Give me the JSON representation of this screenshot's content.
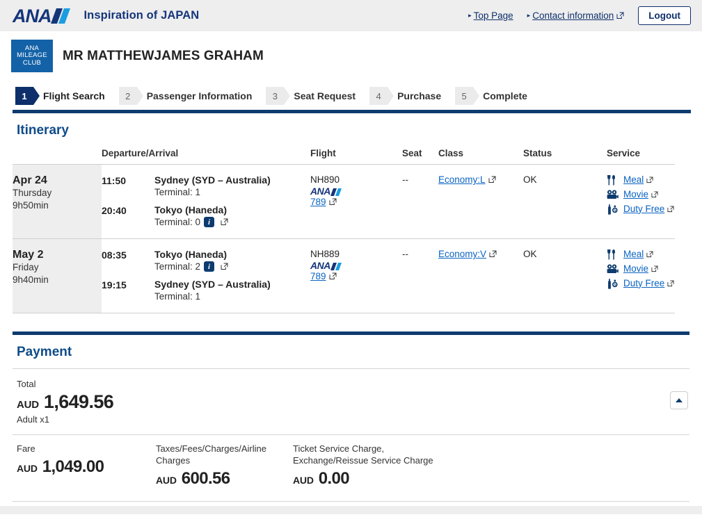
{
  "header": {
    "brand_text": "ANA",
    "tagline": "Inspiration of JAPAN",
    "top_page_label": "Top Page",
    "contact_label": "Contact information",
    "logout_label": "Logout"
  },
  "member": {
    "badge_line1": "ANA",
    "badge_line2": "MILEAGE",
    "badge_line3": "CLUB",
    "name": "MR MATTHEWJAMES GRAHAM"
  },
  "steps": [
    {
      "num": "1",
      "label": "Flight Search",
      "active": true
    },
    {
      "num": "2",
      "label": "Passenger Information",
      "active": false
    },
    {
      "num": "3",
      "label": "Seat Request",
      "active": false
    },
    {
      "num": "4",
      "label": "Purchase",
      "active": false
    },
    {
      "num": "5",
      "label": "Complete",
      "active": false
    }
  ],
  "itinerary": {
    "title": "Itinerary",
    "columns": {
      "date": "",
      "departure_arrival": "Departure/Arrival",
      "flight": "Flight",
      "seat": "Seat",
      "class": "Class",
      "status": "Status",
      "service": "Service"
    },
    "rows": [
      {
        "date": "Apr 24",
        "weekday": "Thursday",
        "duration": "9h50min",
        "dep_time": "11:50",
        "dep_place": "Sydney (SYD – Australia)",
        "dep_terminal": "Terminal: 1",
        "dep_has_info": false,
        "arr_time": "20:40",
        "arr_place": "Tokyo (Haneda)",
        "arr_terminal": "Terminal: 0",
        "arr_has_info": true,
        "flight_no": "NH890",
        "aircraft": "789",
        "seat": "--",
        "class": "Economy:L",
        "status": "OK",
        "services": [
          {
            "icon": "meal-icon",
            "label": "Meal"
          },
          {
            "icon": "movie-icon",
            "label": "Movie"
          },
          {
            "icon": "duty-free-icon",
            "label": "Duty Free"
          }
        ]
      },
      {
        "date": "May 2",
        "weekday": "Friday",
        "duration": "9h40min",
        "dep_time": "08:35",
        "dep_place": "Tokyo (Haneda)",
        "dep_terminal": "Terminal: 2",
        "dep_has_info": true,
        "arr_time": "19:15",
        "arr_place": "Sydney (SYD – Australia)",
        "arr_terminal": "Terminal: 1",
        "arr_has_info": false,
        "flight_no": "NH889",
        "aircraft": "789",
        "seat": "--",
        "class": "Economy:V",
        "status": "OK",
        "services": [
          {
            "icon": "meal-icon",
            "label": "Meal"
          },
          {
            "icon": "movie-icon",
            "label": "Movie"
          },
          {
            "icon": "duty-free-icon",
            "label": "Duty Free"
          }
        ]
      }
    ]
  },
  "payment": {
    "title": "Payment",
    "total_label": "Total",
    "total_currency": "AUD",
    "total_value": "1,649.56",
    "passengers": "Adult x1",
    "breakdown": [
      {
        "label": "Fare",
        "currency": "AUD",
        "value": "1,049.00"
      },
      {
        "label": "Taxes/Fees/Charges/Airline Charges",
        "currency": "AUD",
        "value": "600.56"
      },
      {
        "label": "Ticket Service Charge, Exchange/Reissue Service Charge",
        "currency": "AUD",
        "value": "0.00"
      }
    ]
  },
  "colors": {
    "navy": "#0d3b6e",
    "brand_blue": "#15357a",
    "accent_blue": "#1b9de0",
    "link_blue": "#0a63c2",
    "heading_blue": "#0f4c8a"
  }
}
